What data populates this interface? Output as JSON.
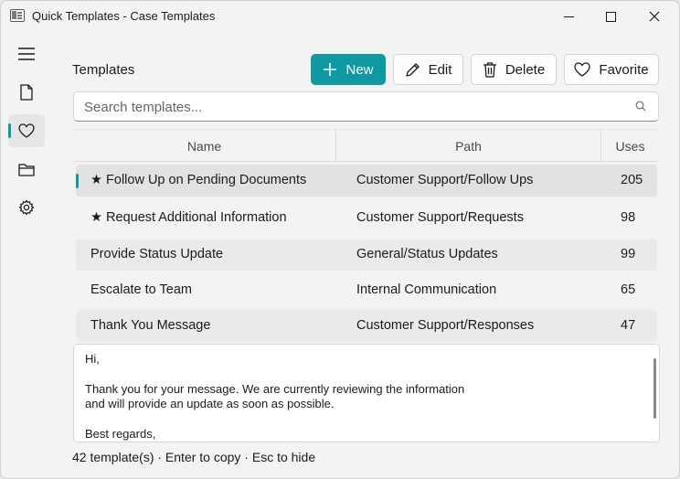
{
  "window": {
    "title": "Quick Templates - Case Templates"
  },
  "sidebar": {
    "items": [
      {
        "name": "menu",
        "icon": "hamburger-icon",
        "active": false
      },
      {
        "name": "document",
        "icon": "document-icon",
        "active": false
      },
      {
        "name": "favorites",
        "icon": "heart-icon",
        "active": true
      },
      {
        "name": "folder",
        "icon": "folder-icon",
        "active": false
      },
      {
        "name": "settings",
        "icon": "gear-icon",
        "active": false
      }
    ]
  },
  "header": {
    "title": "Templates",
    "buttons": {
      "new": "New",
      "edit": "Edit",
      "delete": "Delete",
      "favorite": "Favorite"
    }
  },
  "search": {
    "placeholder": "Search templates...",
    "value": ""
  },
  "table": {
    "columns": [
      "Name",
      "Path",
      "Uses"
    ],
    "rows": [
      {
        "name": "★ Follow Up on Pending Documents",
        "path": "Customer Support/Follow Ups",
        "uses": "205",
        "selected": true
      },
      {
        "name": "★ Request Additional Information",
        "path": "Customer Support/Requests",
        "uses": "98",
        "selected": false
      },
      {
        "name": "Provide Status Update",
        "path": "General/Status Updates",
        "uses": "99",
        "selected": false
      },
      {
        "name": "Escalate to Team",
        "path": "Internal Communication",
        "uses": "65",
        "selected": false
      },
      {
        "name": "Thank You Message",
        "path": "Customer Support/Responses",
        "uses": "47",
        "selected": false
      }
    ]
  },
  "preview": {
    "line1": "Hi,",
    "line2": "Thank you for your message. We are currently reviewing the information",
    "line3": "and will provide an update as soon as possible.",
    "line4": "Best regards,"
  },
  "status": {
    "text": "42 template(s) · Enter to copy · Esc to hide"
  },
  "colors": {
    "accent": "#0f9aa3",
    "window_bg": "#f3f3f3"
  }
}
